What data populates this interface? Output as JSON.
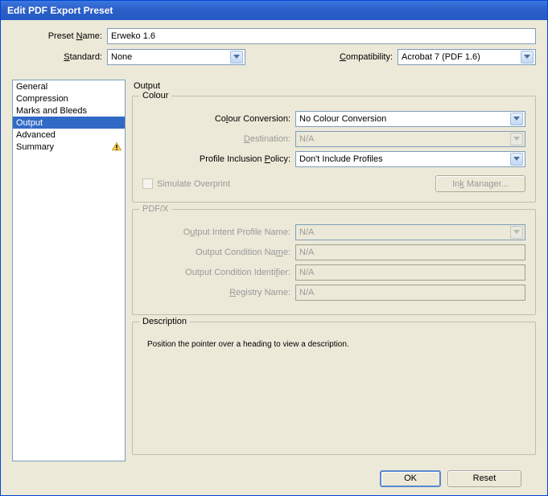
{
  "window": {
    "title": "Edit PDF Export Preset"
  },
  "top": {
    "preset_label_pre": "Preset ",
    "preset_label_u": "N",
    "preset_label_post": "ame:",
    "preset_value": "Erweko 1.6",
    "standard_label_u": "S",
    "standard_label_post": "tandard:",
    "standard_value": "None",
    "compat_label_u": "C",
    "compat_label_post": "ompatibility:",
    "compat_value": "Acrobat 7 (PDF 1.6)"
  },
  "sidebar": {
    "items": [
      {
        "label": "General"
      },
      {
        "label": "Compression"
      },
      {
        "label": "Marks and Bleeds"
      },
      {
        "label": "Output"
      },
      {
        "label": "Advanced"
      },
      {
        "label": "Summary"
      }
    ]
  },
  "panel": {
    "title": "Output",
    "colour": {
      "legend": "Colour",
      "conversion_label_pre": "Co",
      "conversion_label_u": "l",
      "conversion_label_post": "our Conversion:",
      "conversion_value": "No Colour Conversion",
      "destination_label_u": "D",
      "destination_label_post": "estination:",
      "destination_value": "N/A",
      "policy_label_pre": "Profile Inclusion ",
      "policy_label_u": "P",
      "policy_label_post": "olicy:",
      "policy_value": "Don't Include Profiles",
      "simulate_label": "Simulate Overprint",
      "ink_label_pre": "In",
      "ink_label_u": "k",
      "ink_label_post": " Manager..."
    },
    "pdfx": {
      "legend": "PDF/X",
      "profile_label_pre": "O",
      "profile_label_u": "u",
      "profile_label_post": "tput Intent Profile Name:",
      "profile_value": "N/A",
      "condname_label_pre": "Output Condition Na",
      "condname_label_u": "m",
      "condname_label_post": "e:",
      "condname_value": "N/A",
      "condid_label_pre": "Output Condition Identi",
      "condid_label_u": "f",
      "condid_label_post": "ier:",
      "condid_value": "N/A",
      "registry_label_u": "R",
      "registry_label_post": "egistry Name:",
      "registry_value": "N/A"
    },
    "description": {
      "legend": "Description",
      "text": "Position the pointer over a heading to view a description."
    }
  },
  "buttons": {
    "ok": "OK",
    "reset": "Reset"
  }
}
